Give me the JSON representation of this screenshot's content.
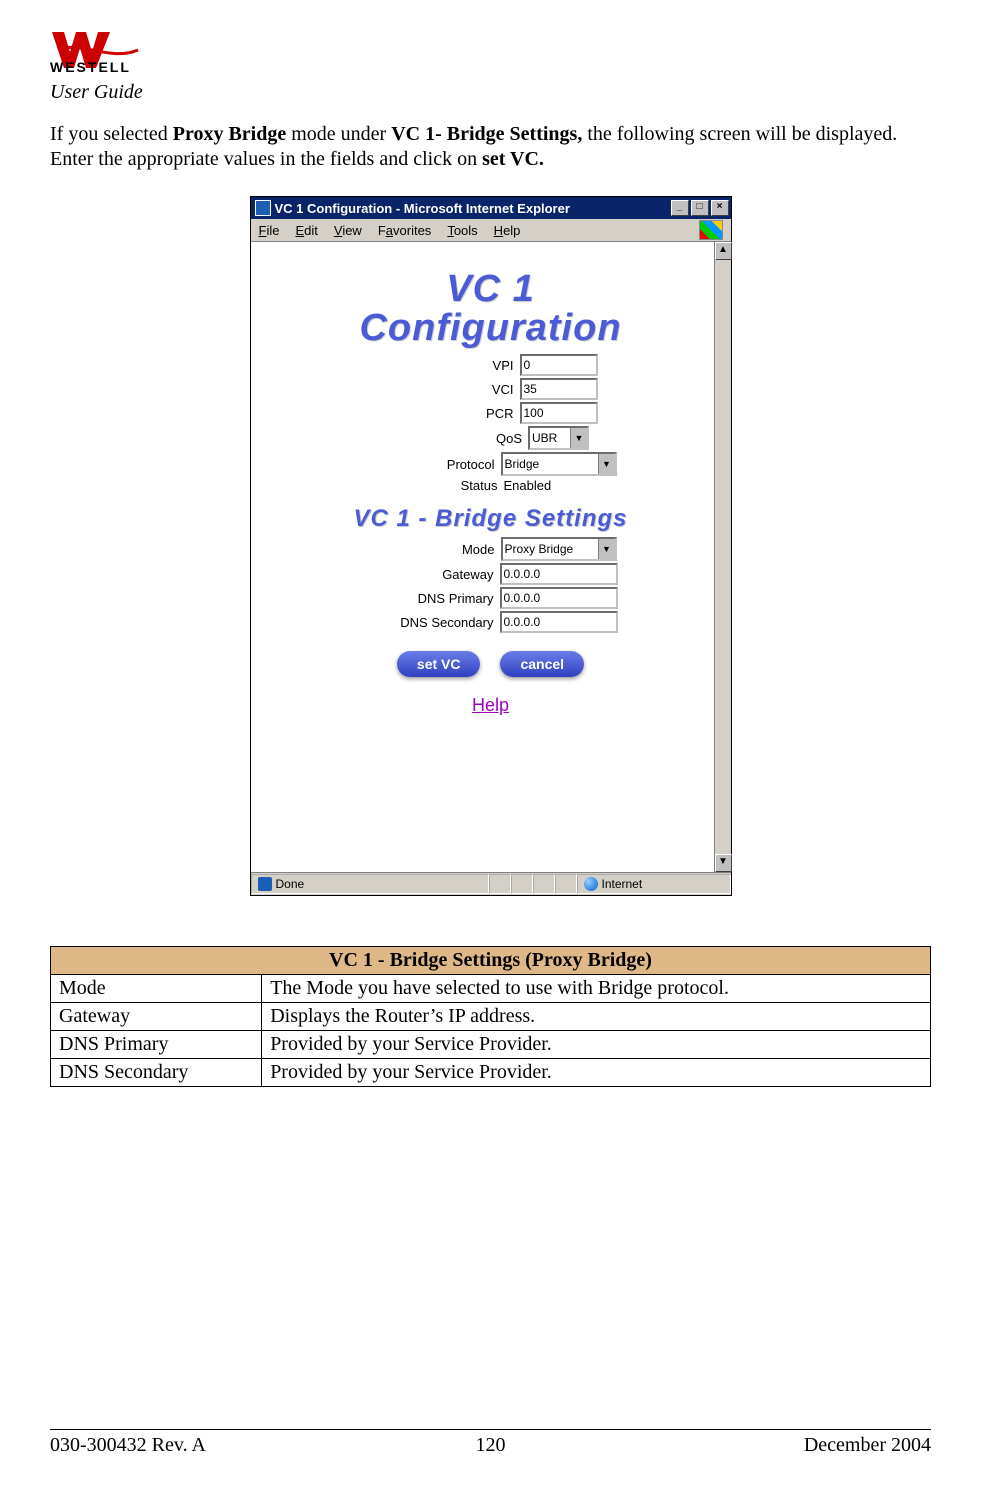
{
  "header": {
    "brand_upper": "WESTELL",
    "subtitle": "User Guide"
  },
  "para": {
    "t1": "If you selected ",
    "b1": "Proxy Bridge",
    "t2": " mode under ",
    "b2": "VC 1- Bridge Settings,",
    "t3": " the following screen will be displayed. Enter the appropriate values in the fields and click on ",
    "b3": "set VC."
  },
  "window": {
    "title": "VC 1 Configuration - Microsoft Internet Explorer",
    "menu": {
      "file": "File",
      "edit": "Edit",
      "view": "View",
      "favorites": "Favorites",
      "tools": "Tools",
      "help": "Help"
    },
    "heading1": "VC 1",
    "heading2": "Configuration",
    "fields_top": [
      {
        "label": "VPI",
        "value": "0",
        "type": "text"
      },
      {
        "label": "VCI",
        "value": "35",
        "type": "text"
      },
      {
        "label": "PCR",
        "value": "100",
        "type": "text"
      },
      {
        "label": "QoS",
        "value": "UBR",
        "type": "select"
      },
      {
        "label": "Protocol",
        "value": "Bridge",
        "type": "select-wide"
      },
      {
        "label": "Status",
        "value": "Enabled",
        "type": "plain"
      }
    ],
    "heading3": "VC 1 - Bridge Settings",
    "fields_bot": [
      {
        "label": "Mode",
        "value": "Proxy Bridge",
        "type": "select-wide"
      },
      {
        "label": "Gateway",
        "value": "0.0.0.0",
        "type": "text-wide"
      },
      {
        "label": "DNS Primary",
        "value": "0.0.0.0",
        "type": "text-wide"
      },
      {
        "label": "DNS Secondary",
        "value": "0.0.0.0",
        "type": "text-wide"
      }
    ],
    "buttons": {
      "set": "set VC",
      "cancel": "cancel"
    },
    "help": "Help",
    "status_done": "Done",
    "status_zone": "Internet"
  },
  "table": {
    "title": "VC 1 - Bridge Settings (Proxy Bridge)",
    "rows": [
      {
        "k": "Mode",
        "v": "The Mode you have selected to use with Bridge protocol."
      },
      {
        "k": "Gateway",
        "v": "Displays the Router’s IP address."
      },
      {
        "k": "DNS Primary",
        "v": "Provided by your Service Provider."
      },
      {
        "k": "DNS Secondary",
        "v": "Provided by your Service Provider."
      }
    ]
  },
  "footer": {
    "left": "030-300432 Rev. A",
    "center": "120",
    "right": "December 2004"
  }
}
